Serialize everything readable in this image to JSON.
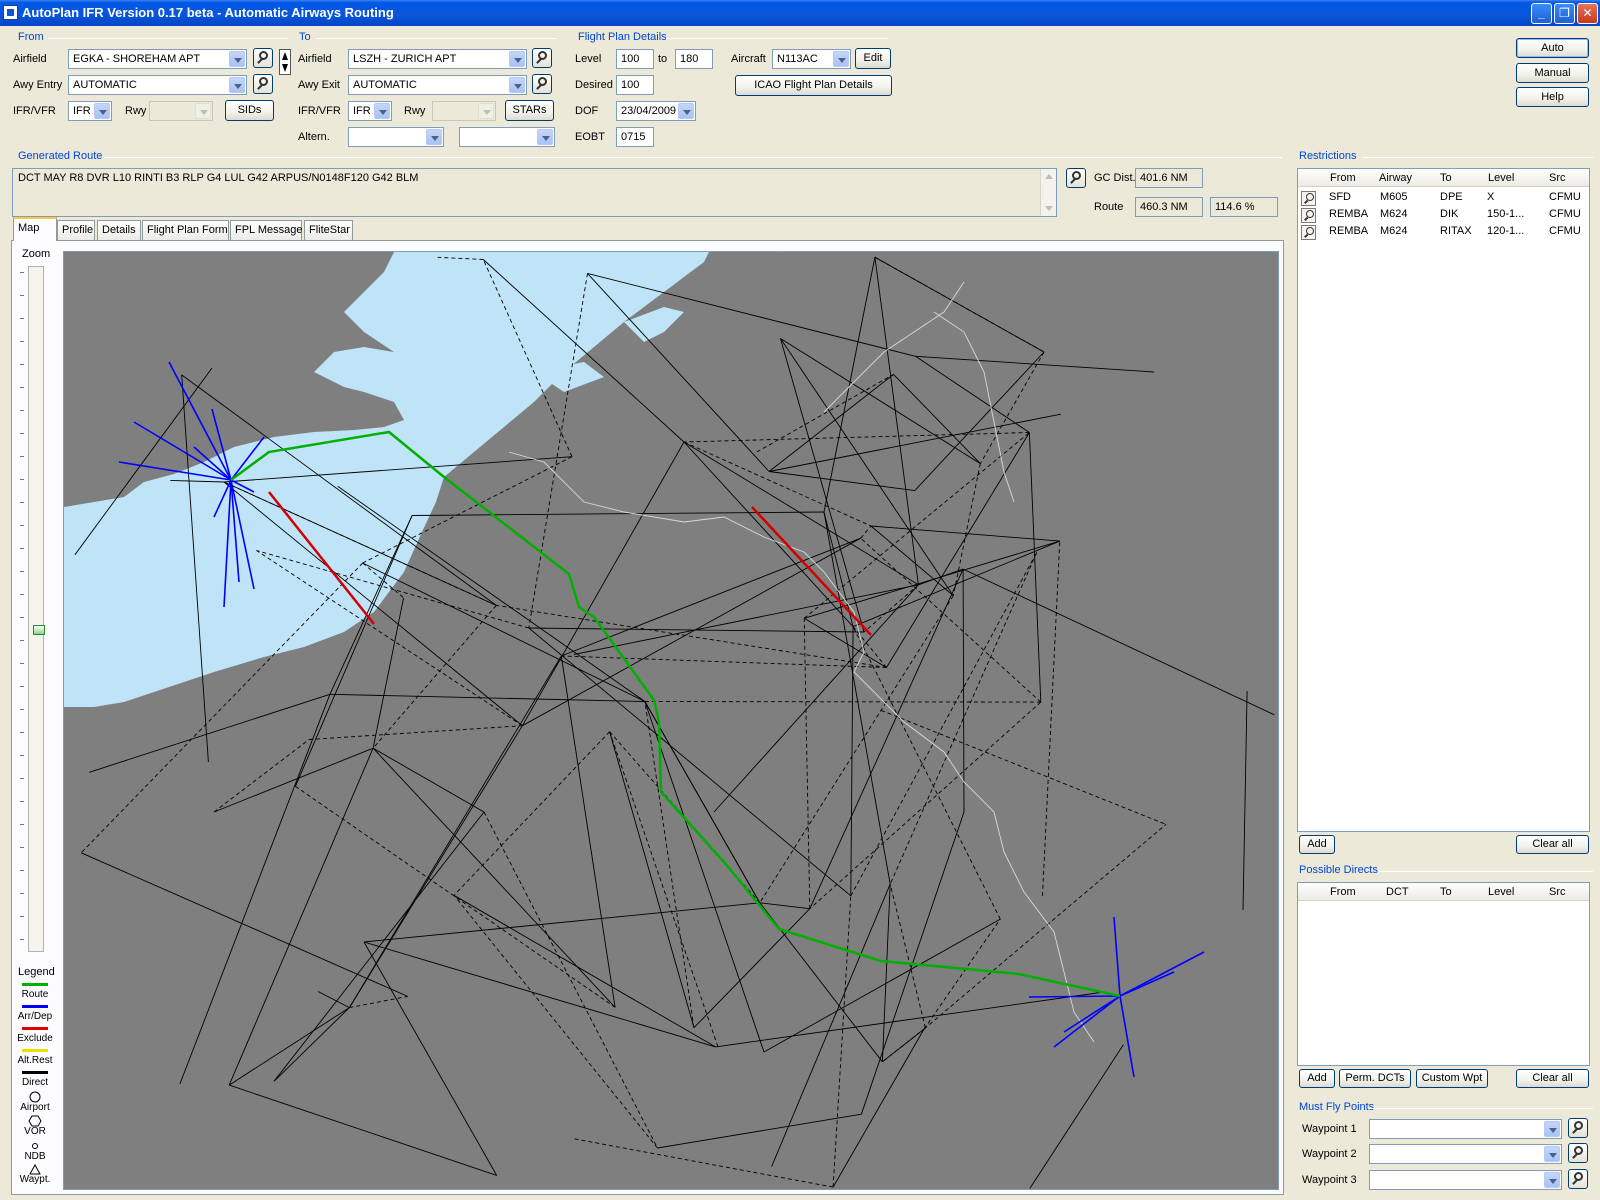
{
  "window": {
    "title": "AutoPlan IFR Version 0.17 beta - Automatic Airways Routing",
    "controls": [
      "_",
      "❐",
      "✕"
    ]
  },
  "from": {
    "heading": "From",
    "airfield_label": "Airfield",
    "airfield": "EGKA - SHOREHAM APT",
    "awy_entry_label": "Awy Entry",
    "awy_entry": "AUTOMATIC",
    "ifrvfr_label": "IFR/VFR",
    "ifrvfr": "IFR",
    "rwy_label": "Rwy",
    "rwy": "",
    "sids_button": "SIDs"
  },
  "to": {
    "heading": "To",
    "airfield_label": "Airfield",
    "airfield": "LSZH - ZURICH APT",
    "awy_exit_label": "Awy Exit",
    "awy_exit": "AUTOMATIC",
    "ifrvfr_label": "IFR/VFR",
    "ifrvfr": "IFR",
    "rwy_label": "Rwy",
    "rwy": "",
    "stars_button": "STARs",
    "altern_label": "Altern.",
    "altern1": "",
    "altern2": ""
  },
  "flightplan": {
    "heading": "Flight Plan Details",
    "level_label": "Level",
    "level_from": "100",
    "level_to_label": "to",
    "level_to": "180",
    "desired_label": "Desired",
    "desired": "100",
    "dof_label": "DOF",
    "dof": "23/04/2009",
    "eobt_label": "EOBT",
    "eobt": "0715",
    "aircraft_label": "Aircraft",
    "aircraft": "N113AC",
    "edit_button": "Edit",
    "icao_button": "ICAO Flight Plan Details"
  },
  "mode_buttons": {
    "auto": "Auto",
    "manual": "Manual",
    "help": "Help"
  },
  "route": {
    "heading": "Generated Route",
    "text": "DCT MAY R8 DVR L10 RINTI B3 RLP G4 LUL G42 ARPUS/N0148F120 G42 BLM",
    "gc_dist_label": "GC Dist.",
    "gc_dist": "401.6 NM",
    "route_label": "Route",
    "route_dist": "460.3 NM",
    "route_pct": "114.6 %"
  },
  "tabs": [
    "Map",
    "Profile",
    "Details",
    "Flight Plan Form",
    "FPL Message",
    "FliteStar"
  ],
  "zoom_label": "Zoom",
  "legend": {
    "heading": "Legend",
    "items": [
      {
        "label": "Route",
        "color": "#00b000"
      },
      {
        "label": "Arr/Dep",
        "color": "#0000ff"
      },
      {
        "label": "Exclude",
        "color": "#e00000"
      },
      {
        "label": "Alt.Rest",
        "color": "#e8e000"
      },
      {
        "label": "Direct",
        "color": "#000000"
      },
      {
        "label": "Airport",
        "icon": "airport-icon"
      },
      {
        "label": "VOR",
        "icon": "vor-icon"
      },
      {
        "label": "NDB",
        "icon": "ndb-icon"
      },
      {
        "label": "Waypt.",
        "icon": "waypoint-icon"
      }
    ]
  },
  "map_colors": {
    "land": "#7f7f7f",
    "sea": "#bfe3f7",
    "route": "#00b000",
    "arrdep": "#0000ff",
    "exclude": "#d40000",
    "airway": "#000000",
    "border": "#d9d9d9"
  },
  "restrictions": {
    "heading": "Restrictions",
    "columns": [
      "From",
      "Airway",
      "To",
      "Level",
      "Src"
    ],
    "rows": [
      [
        "SFD",
        "M605",
        "DPE",
        "X",
        "CFMU"
      ],
      [
        "REMBA",
        "M624",
        "DIK",
        "150-1...",
        "CFMU"
      ],
      [
        "REMBA",
        "M624",
        "RITAX",
        "120-1...",
        "CFMU"
      ]
    ],
    "add_button": "Add",
    "clear_button": "Clear all"
  },
  "directs": {
    "heading": "Possible Directs",
    "columns": [
      "From",
      "DCT",
      "To",
      "Level",
      "Src"
    ],
    "add_button": "Add",
    "perm_button": "Perm. DCTs",
    "custom_button": "Custom Wpt",
    "clear_button": "Clear all"
  },
  "mustfly": {
    "heading": "Must Fly Points",
    "waypoints": [
      {
        "label": "Waypoint 1",
        "value": ""
      },
      {
        "label": "Waypoint 2",
        "value": ""
      },
      {
        "label": "Waypoint 3",
        "value": ""
      }
    ]
  }
}
